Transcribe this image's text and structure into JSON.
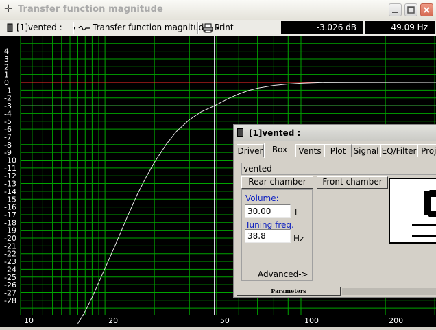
{
  "window": {
    "title": "Transfer function magnitude",
    "icon": "crosshair-icon"
  },
  "toolbar": {
    "project_label": "[1]vented :",
    "plot_label": "Transfer function magnitude",
    "print_label": "Print",
    "readout_db": "-3.026 dB",
    "readout_freq": "49.09 Hz"
  },
  "plot": {
    "y_ticks": [
      "4",
      "3",
      "2",
      "1",
      "0",
      "-1",
      "-2",
      "-3",
      "-4",
      "-5",
      "-6",
      "-7",
      "-8",
      "-9",
      "-10",
      "-11",
      "-12",
      "-13",
      "-14",
      "-15",
      "-16",
      "-17",
      "-18",
      "-19",
      "-20",
      "-21",
      "-22",
      "-23",
      "-24",
      "-25",
      "-26",
      "-27",
      "-28"
    ],
    "x_tick_labels": [
      "10",
      "20",
      "50",
      "100",
      "200"
    ],
    "colors": {
      "background": "#000000",
      "grid": "#00a400",
      "curve": "#e8e8e8",
      "reference": "#ff2a2a",
      "cursor": "#f0f0ff"
    },
    "cursor": {
      "freq_hz": 49.09,
      "db": -3.026
    },
    "curve_hz": [
      16,
      17,
      18,
      19,
      20,
      22,
      24,
      26,
      28,
      30,
      33,
      36,
      40,
      44,
      49.09,
      55,
      60,
      65,
      70,
      80,
      90,
      100,
      110,
      120
    ],
    "curve_db": [
      -31,
      -29.4,
      -27.6,
      -25.7,
      -23.9,
      -20.5,
      -17.3,
      -14.5,
      -12.2,
      -10.3,
      -8.0,
      -6.3,
      -4.8,
      -3.8,
      -3.026,
      -2.1,
      -1.5,
      -1.05,
      -0.75,
      -0.4,
      -0.22,
      -0.12,
      -0.06,
      -0.03
    ]
  },
  "panel": {
    "title": "[1]vented :",
    "tabs": [
      "Driver",
      "Box",
      "Vents",
      "Plot",
      "Signal",
      "EQ/Filter",
      "Proje"
    ],
    "active_tab": "Box",
    "box_name": "vented",
    "rear_button": "Rear chamber",
    "front_button": "Front chamber",
    "volume_label": "Volume:",
    "volume_value": "30.00",
    "volume_unit": "l",
    "tuning_label": "Tuning freq.",
    "tuning_value": "38.8",
    "tuning_unit": "Hz",
    "advanced_label": "Advanced->",
    "status_tab": "Parameters"
  }
}
